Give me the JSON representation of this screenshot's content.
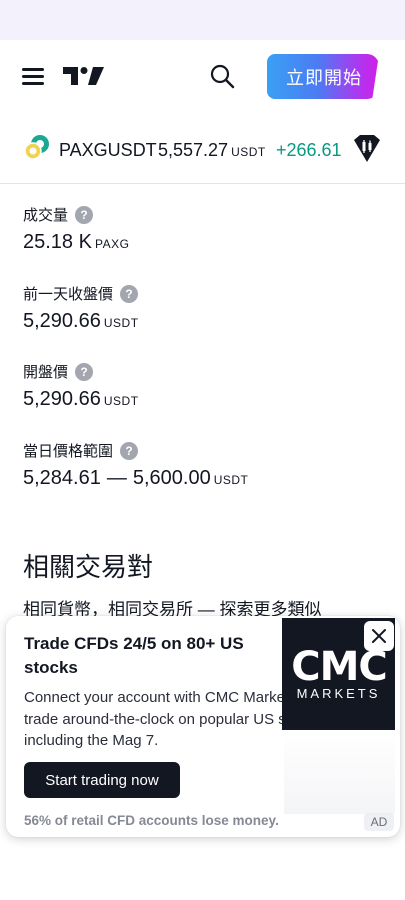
{
  "header": {
    "cta_label": "立即開始",
    "icons": {
      "menu": "hamburger-menu-icon",
      "logo": "tradingview-logo",
      "search": "search-icon"
    }
  },
  "ticker": {
    "symbol": "PAXGUSDT",
    "price": "5,557.27",
    "price_unit": "USDT",
    "change": "+266.61",
    "change_color": "#089981",
    "coin_icon": "paxg-coin-icon",
    "chart_icon": "candlestick-chart-icon"
  },
  "stats": [
    {
      "label": "成交量",
      "value": "25.18 K",
      "unit": "PAXG"
    },
    {
      "label": "前一天收盤價",
      "value": "5,290.66",
      "unit": "USDT"
    },
    {
      "label": "開盤價",
      "value": "5,290.66",
      "unit": "USDT"
    },
    {
      "label": "當日價格範圍",
      "low": "5,284.61",
      "separator": "—",
      "high": "5,600.00",
      "unit": "USDT"
    }
  ],
  "help_glyph": "?",
  "related": {
    "title": "相關交易對",
    "subtitle": "相同貨幣，相同交易所 — 探索更多類似"
  },
  "ad": {
    "title": "Trade CFDs 24/5 on 80+ US stocks",
    "body": "Connect your account with CMC Markets and trade around-the-clock on popular US shares, including the Mag 7.",
    "cta_label": "Start trading now",
    "disclaimer": "56% of retail CFD accounts lose money.",
    "badge": "AD",
    "logo_top": "CMC",
    "logo_bottom": "MARKETS",
    "close_icon": "close-icon"
  }
}
